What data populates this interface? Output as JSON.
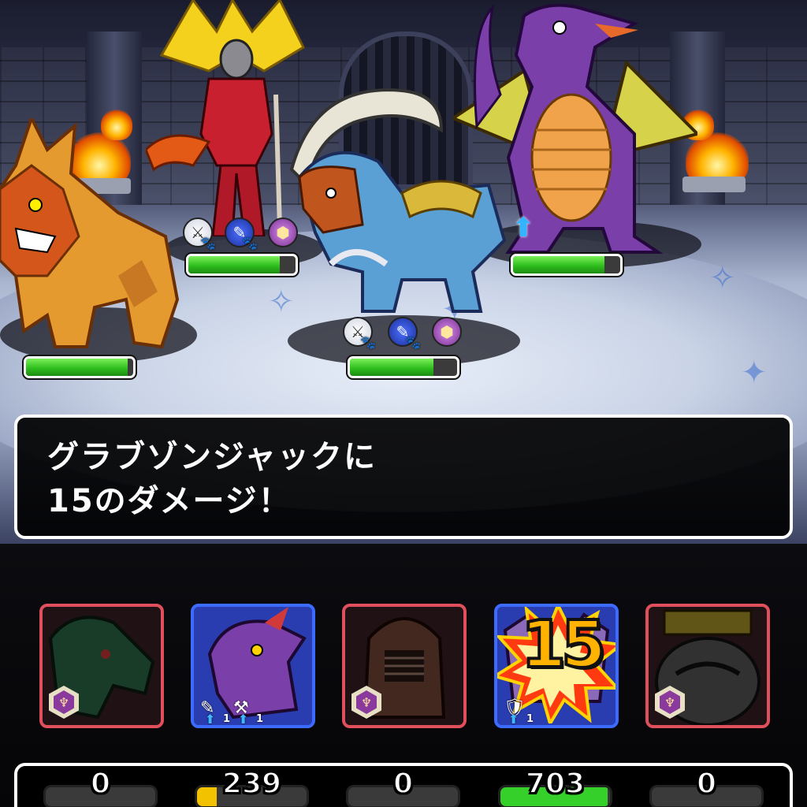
{
  "battle": {
    "message_line1": "グラブゾンジャックに",
    "message_line2": "15のダメージ！",
    "enemies": [
      {
        "name": "golden-beast",
        "hp_fraction": 0.95
      },
      {
        "name": "feathered-sorceress",
        "hp_fraction": 0.85
      },
      {
        "name": "armored-lion",
        "hp_fraction": 0.78
      },
      {
        "name": "purple-dragon",
        "hp_fraction": 0.85
      }
    ]
  },
  "party": {
    "members": [
      {
        "portrait": "green-dragon-icon",
        "state": "disabled",
        "gauge_value": "0",
        "gauge_fraction": 0.0,
        "gauge_color": "#f2c200"
      },
      {
        "portrait": "purple-dragon-icon",
        "state": "active",
        "gauge_value": "239",
        "gauge_fraction": 0.18,
        "gauge_color": "#f2c200",
        "buff_level_1": "1",
        "buff_level_2": "1"
      },
      {
        "portrait": "armored-knight-icon",
        "state": "disabled",
        "gauge_value": "0",
        "gauge_fraction": 0.0,
        "gauge_color": "#f2c200"
      },
      {
        "portrait": "winged-demon-icon",
        "state": "active",
        "gauge_value": "703",
        "gauge_fraction": 0.98,
        "gauge_color": "#35d12a",
        "damage": "15",
        "buff_level_1": "1"
      },
      {
        "portrait": "crowned-beast-icon",
        "state": "disabled",
        "gauge_value": "0",
        "gauge_fraction": 0.0,
        "gauge_color": "#f2c200"
      }
    ]
  },
  "colors": {
    "hp_green": "#2fbf1e",
    "disabled_border": "#e0505c",
    "active_border": "#3c6cff",
    "damage_text": "#ffb300"
  }
}
